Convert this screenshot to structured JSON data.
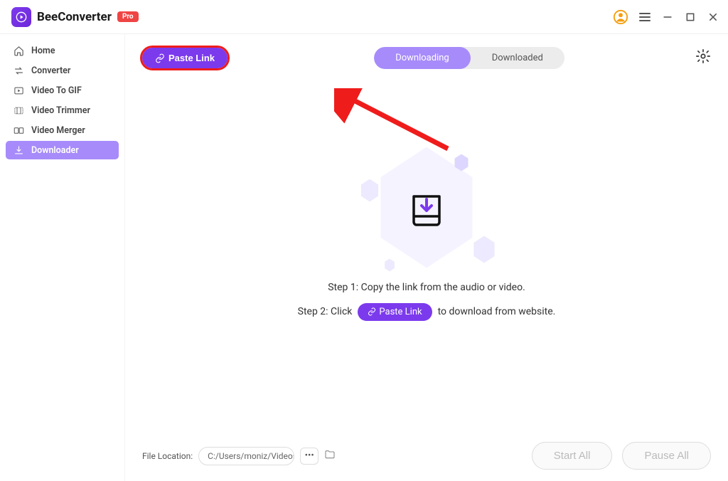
{
  "app": {
    "name": "BeeConverter",
    "badge": "Pro"
  },
  "sidebar": {
    "items": [
      {
        "label": "Home"
      },
      {
        "label": "Converter"
      },
      {
        "label": "Video To GIF"
      },
      {
        "label": "Video Trimmer"
      },
      {
        "label": "Video Merger"
      },
      {
        "label": "Downloader"
      }
    ]
  },
  "toolbar": {
    "paste_label": "Paste Link"
  },
  "tabs": {
    "downloading": "Downloading",
    "downloaded": "Downloaded"
  },
  "center": {
    "step1": "Step 1: Copy the link from the audio or video.",
    "step2_pre": "Step 2: Click",
    "step2_btn": "Paste Link",
    "step2_post": "to download from website."
  },
  "footer": {
    "file_location_label": "File Location:",
    "file_location_value": "C:/Users/moniz/Videos/Be",
    "start_all": "Start All",
    "pause_all": "Pause All"
  }
}
